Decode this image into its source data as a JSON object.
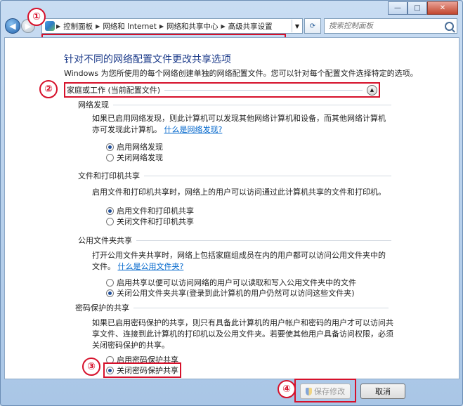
{
  "window": {
    "caption": {
      "minimize": "—",
      "maximize": "□",
      "close": "✕"
    }
  },
  "nav": {
    "breadcrumb": [
      "控制面板",
      "网络和 Internet",
      "网络和共享中心",
      "高级共享设置"
    ],
    "search_placeholder": "搜索控制面板"
  },
  "page": {
    "title": "针对不同的网络配置文件更改共享选项",
    "description": "Windows 为您所使用的每个网络创建单独的网络配置文件。您可以针对每个配置文件选择特定的选项。",
    "profile_label": "家庭或工作 (当前配置文件)"
  },
  "sections": {
    "discovery": {
      "heading": "网络发现",
      "text": "如果已启用网络发现，则此计算机可以发现其他网络计算机和设备，而其他网络计算机亦可发现此计算机。",
      "link": "什么是网络发现?",
      "options": [
        "启用网络发现",
        "关闭网络发现"
      ],
      "selected": 0
    },
    "file_print": {
      "heading": "文件和打印机共享",
      "text": "启用文件和打印机共享时，网络上的用户可以访问通过此计算机共享的文件和打印机。",
      "options": [
        "启用文件和打印机共享",
        "关闭文件和打印机共享"
      ],
      "selected": 0
    },
    "public_folder": {
      "heading": "公用文件夹共享",
      "text": "打开公用文件夹共享时，网络上包括家庭组成员在内的用户都可以访问公用文件夹中的文件。",
      "link": "什么是公用文件夹?",
      "options": [
        "启用共享以便可以访问网络的用户可以读取和写入公用文件夹中的文件",
        "关闭公用文件夹共享(登录到此计算机的用户仍然可以访问这些文件夹)"
      ],
      "selected": 1
    },
    "password": {
      "heading": "密码保护的共享",
      "text": "如果已启用密码保护的共享，则只有具备此计算机的用户帐户和密码的用户才可以访问共享文件、连接到此计算机的打印机以及公用文件夹。若要使其他用户具备访问权限，必须关闭密码保护的共享。",
      "options": [
        "启用密码保护共享",
        "关闭密码保护共享"
      ],
      "selected": 1
    }
  },
  "footer": {
    "save_label": "保存修改",
    "cancel_label": "取消"
  },
  "annotations": [
    "①",
    "②",
    "③",
    "④"
  ],
  "colors": {
    "highlight": "#d6112b",
    "title": "#1c3b8a",
    "link": "#0066cc"
  }
}
